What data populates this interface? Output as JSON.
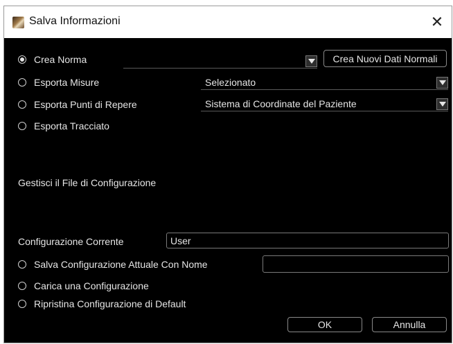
{
  "window": {
    "title": "Salva Informazioni",
    "icon": "app-icon",
    "close_glyph": "✕"
  },
  "options": [
    {
      "label": "Crea Norma",
      "checked": true
    },
    {
      "label": "Esporta Misure",
      "checked": false
    },
    {
      "label": "Esporta Punti di Repere",
      "checked": false
    },
    {
      "label": "Esporta Tracciato",
      "checked": false
    }
  ],
  "crea_norma": {
    "combo_value": "",
    "button_label": "Crea Nuovi Dati Normali"
  },
  "esporta_misure": {
    "combo_value": "Selezionato"
  },
  "esporta_punti": {
    "combo_value": "Sistema di Coordinate del Paziente"
  },
  "config": {
    "section_title": "Gestisci il File di Configurazione",
    "current_label": "Configurazione Corrente",
    "current_value": "User",
    "options": [
      {
        "label": "Salva Configurazione Attuale Con Nome",
        "checked": false
      },
      {
        "label": "Carica una Configurazione",
        "checked": false
      },
      {
        "label": "Ripristina Configurazione di Default",
        "checked": false
      }
    ],
    "save_name_value": ""
  },
  "footer": {
    "ok_label": "OK",
    "cancel_label": "Annulla"
  }
}
